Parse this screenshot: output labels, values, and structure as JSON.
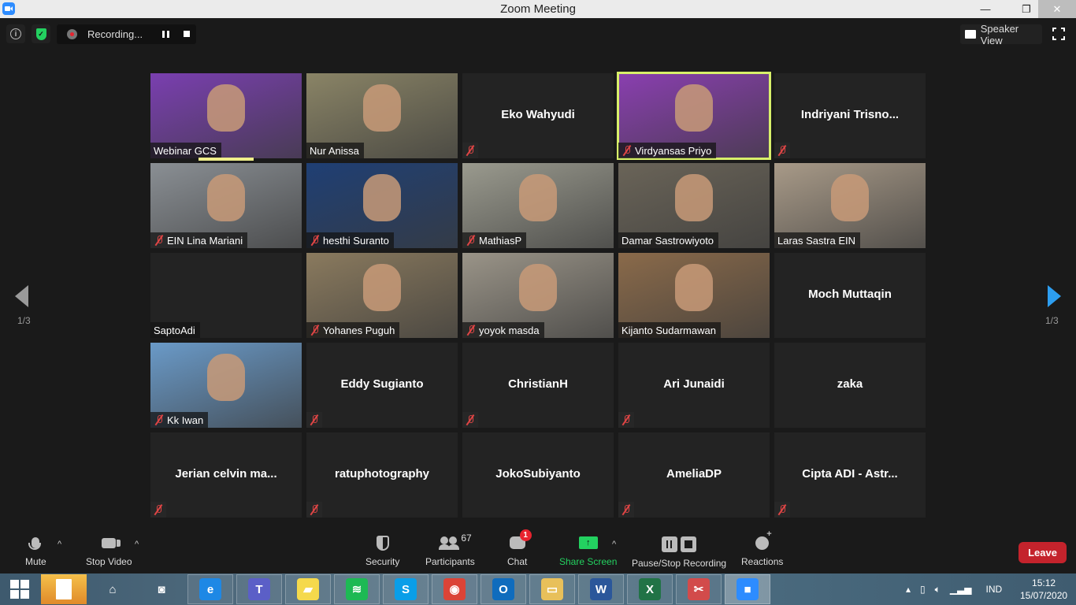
{
  "window": {
    "title": "Zoom Meeting",
    "controls": {
      "minimize": "—",
      "maximize": "❐",
      "close": "✕"
    }
  },
  "topbar": {
    "info_icon": "i",
    "security_icon": "✓",
    "recording_label": "Recording...",
    "view_label": "Speaker View"
  },
  "pagination": {
    "left": "1/3",
    "right": "1/3"
  },
  "participants": [
    {
      "name": "Webinar GCS",
      "video": true,
      "muted": false,
      "bg": "#7a3fb0"
    },
    {
      "name": "Nur Anissa",
      "video": true,
      "muted": false,
      "bg": "#8a8466"
    },
    {
      "name": "Eko Wahyudi",
      "video": false,
      "muted": true
    },
    {
      "name": "Virdyansas Priyo",
      "video": true,
      "muted": true,
      "active": true,
      "bg": "#8a3fb0"
    },
    {
      "name": "Indriyani  Trisno...",
      "video": false,
      "muted": true
    },
    {
      "name": "EIN Lina Mariani",
      "video": true,
      "muted": true,
      "bg": "#8a8f94"
    },
    {
      "name": "hesthi Suranto",
      "video": true,
      "muted": true,
      "bg": "#1f3f74"
    },
    {
      "name": "MathiasP",
      "video": true,
      "muted": true,
      "bg": "#9a9a8e"
    },
    {
      "name": "Damar Sastrowiyoto",
      "video": true,
      "muted": false,
      "bg": "#6a6458"
    },
    {
      "name": "Laras Sastra EIN",
      "video": true,
      "muted": false,
      "bg": "#a89a88"
    },
    {
      "name": "SaptoAdi",
      "video": false,
      "muted": false,
      "label_only": true
    },
    {
      "name": "Yohanes Puguh",
      "video": true,
      "muted": true,
      "bg": "#8a7a5e"
    },
    {
      "name": "yoyok masda",
      "video": true,
      "muted": true,
      "bg": "#9a9488"
    },
    {
      "name": "Kijanto Sudarmawan",
      "video": true,
      "muted": false,
      "bg": "#8a6a4a"
    },
    {
      "name": "Moch Muttaqin",
      "video": false,
      "muted": false
    },
    {
      "name": "Kk Iwan",
      "video": true,
      "muted": true,
      "bg": "#6a9ac8"
    },
    {
      "name": "Eddy Sugianto",
      "video": false,
      "muted": true
    },
    {
      "name": "ChristianH",
      "video": false,
      "muted": true
    },
    {
      "name": "Ari Junaidi",
      "video": false,
      "muted": true
    },
    {
      "name": "zaka",
      "video": false,
      "muted": false
    },
    {
      "name": "Jerian  celvin  ma...",
      "video": false,
      "muted": true
    },
    {
      "name": "ratuphotography",
      "video": false,
      "muted": true
    },
    {
      "name": "JokoSubiyanto",
      "video": false,
      "muted": false
    },
    {
      "name": "AmeliaDP",
      "video": false,
      "muted": true
    },
    {
      "name": "Cipta ADI - Astr...",
      "video": false,
      "muted": true
    }
  ],
  "toolbar": {
    "mute": "Mute",
    "stop_video": "Stop Video",
    "security": "Security",
    "participants": "Participants",
    "participants_count": "67",
    "chat": "Chat",
    "chat_badge": "1",
    "share_screen": "Share Screen",
    "share_icon": "↑",
    "pause_stop_recording": "Pause/Stop Recording",
    "reactions": "Reactions",
    "leave": "Leave",
    "caret": "^"
  },
  "taskbar": {
    "apps": [
      {
        "name": "file-explorer-pinned",
        "glyph": "",
        "color": "#f0b23c"
      },
      {
        "name": "home",
        "glyph": "⌂",
        "color": "transparent"
      },
      {
        "name": "camera-app",
        "glyph": "◙",
        "color": "transparent"
      },
      {
        "name": "internet-explorer",
        "glyph": "e",
        "color": "#1e88e5"
      },
      {
        "name": "microsoft-teams",
        "glyph": "T",
        "color": "#5b5fc7"
      },
      {
        "name": "sticky-notes",
        "glyph": "▰",
        "color": "#f5d94c"
      },
      {
        "name": "spotify",
        "glyph": "≋",
        "color": "#1db954"
      },
      {
        "name": "skype",
        "glyph": "S",
        "color": "#0a9ee8"
      },
      {
        "name": "chrome",
        "glyph": "◉",
        "color": "#db4437"
      },
      {
        "name": "outlook",
        "glyph": "O",
        "color": "#0f6cbd"
      },
      {
        "name": "file-explorer",
        "glyph": "▭",
        "color": "#e8c05a"
      },
      {
        "name": "word",
        "glyph": "W",
        "color": "#2b579a"
      },
      {
        "name": "excel",
        "glyph": "X",
        "color": "#217346"
      },
      {
        "name": "snipping-tool",
        "glyph": "✂",
        "color": "#d24b4b"
      },
      {
        "name": "zoom",
        "glyph": "■",
        "color": "#2d8cff"
      }
    ],
    "language": "IND",
    "time": "15:12",
    "date": "15/07/2020"
  }
}
